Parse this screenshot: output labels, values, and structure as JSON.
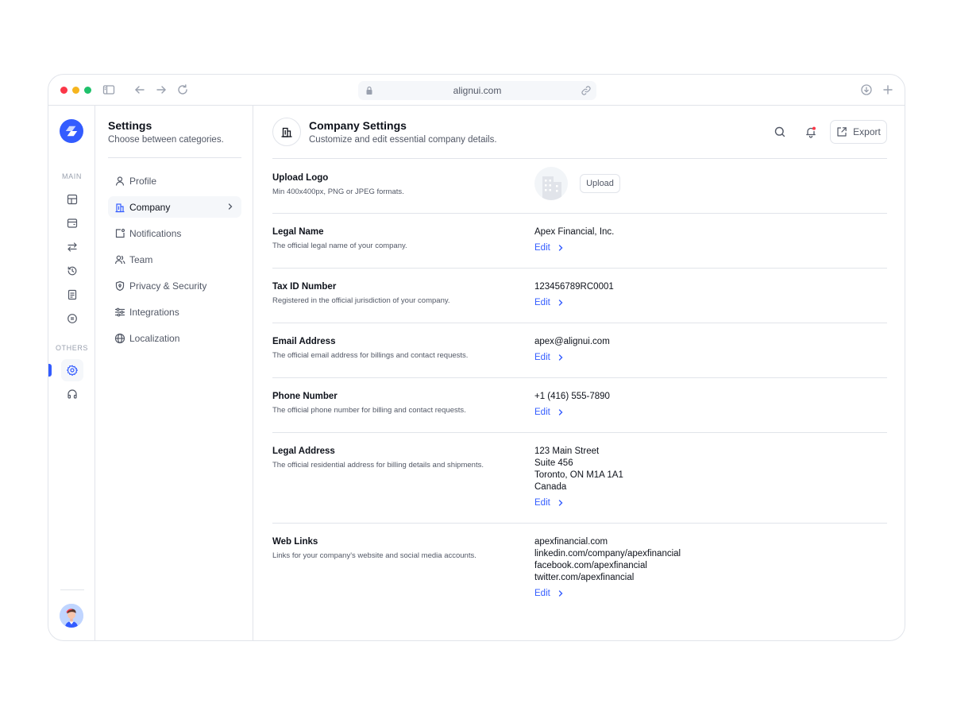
{
  "browser": {
    "url": "alignui.com",
    "traffic_lights": [
      "#fb3748",
      "#f6b51e",
      "#1fc16b"
    ],
    "icons": [
      "sidebar-toggle-icon",
      "back-arrow-icon",
      "forward-arrow-icon",
      "reload-icon",
      "lock-icon",
      "link-icon",
      "download-icon",
      "plus-icon"
    ]
  },
  "rail": {
    "section_main": "MAIN",
    "section_others": "OTHERS",
    "main_icons": [
      "grid-icon",
      "wallet-icon",
      "transfer-icon",
      "history-icon",
      "document-icon",
      "currency-icon"
    ],
    "other_icons": [
      "settings-icon",
      "headphones-icon"
    ],
    "active": "settings-icon"
  },
  "subnav": {
    "title": "Settings",
    "subtitle": "Choose between categories.",
    "items": [
      {
        "label": "Profile",
        "icon": "user-icon"
      },
      {
        "label": "Company",
        "icon": "building-icon",
        "active": true
      },
      {
        "label": "Notifications",
        "icon": "notification-icon"
      },
      {
        "label": "Team",
        "icon": "team-icon"
      },
      {
        "label": "Privacy & Security",
        "icon": "shield-icon"
      },
      {
        "label": "Integrations",
        "icon": "sliders-icon"
      },
      {
        "label": "Localization",
        "icon": "globe-icon"
      }
    ]
  },
  "header": {
    "title": "Company Settings",
    "subtitle": "Customize and edit essential company details.",
    "export_label": "Export"
  },
  "sections": {
    "logo": {
      "label": "Upload Logo",
      "desc": "Min 400x400px, PNG or JPEG formats.",
      "button": "Upload"
    },
    "legal_name": {
      "label": "Legal Name",
      "desc": "The official legal name of your company.",
      "value": "Apex Financial, Inc.",
      "edit": "Edit"
    },
    "tax_id": {
      "label": "Tax ID Number",
      "desc": "Registered in the official jurisdiction of your company.",
      "value": "123456789RC0001",
      "edit": "Edit"
    },
    "email": {
      "label": "Email Address",
      "desc": "The official email address for billings and contact requests.",
      "value": "apex@alignui.com",
      "edit": "Edit"
    },
    "phone": {
      "label": "Phone Number",
      "desc": "The official phone number for billing and contact requests.",
      "value": "+1 (416) 555-7890",
      "edit": "Edit"
    },
    "address": {
      "label": "Legal Address",
      "desc": "The official residential address for billing details and shipments.",
      "lines": [
        "123 Main Street",
        "Suite 456",
        "Toronto, ON M1A 1A1",
        "Canada"
      ],
      "edit": "Edit"
    },
    "web": {
      "label": "Web Links",
      "desc": "Links for your company's website and social media accounts.",
      "lines": [
        "apexfinancial.com",
        "linkedin.com/company/apexfinancial",
        "facebook.com/apexfinancial",
        "twitter.com/apexfinancial"
      ],
      "edit": "Edit"
    }
  },
  "colors": {
    "accent": "#335cff",
    "text": "#0e121b",
    "muted": "#525866",
    "border": "#e1e4ea",
    "notification_dot": "#fb3748"
  }
}
